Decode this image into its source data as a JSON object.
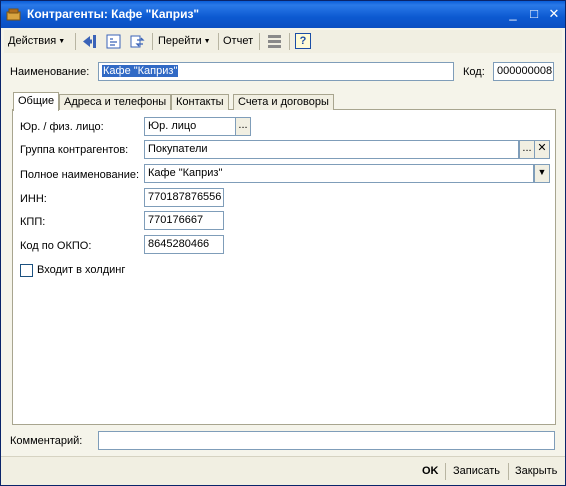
{
  "window": {
    "title": "Контрагенты: Кафе \"Каприз\"",
    "controls": {
      "minimize": "_",
      "maximize": "□",
      "close": "✕"
    }
  },
  "toolbar": {
    "actions_label": "Действия",
    "goto_label": "Перейти",
    "report_label": "Отчет",
    "help_label": "?"
  },
  "header": {
    "name_label": "Наименование:",
    "name_value": "Кафе \"Каприз\"",
    "code_label": "Код:",
    "code_value": "000000008"
  },
  "tabs": [
    {
      "label": "Общие",
      "active": true
    },
    {
      "label": "Адреса и телефоны",
      "active": false
    },
    {
      "label": "Контакты",
      "active": false
    },
    {
      "label": "Счета и договоры",
      "active": false
    }
  ],
  "general": {
    "entity_type_label": "Юр. / физ. лицо:",
    "entity_type_value": "Юр. лицо",
    "group_label": "Группа контрагентов:",
    "group_value": "Покупатели",
    "full_name_label": "Полное наименование:",
    "full_name_value": "Кафе \"Каприз\"",
    "inn_label": "ИНН:",
    "inn_value": "770187876556",
    "kpp_label": "КПП:",
    "kpp_value": "770176667",
    "okpo_label": "Код по ОКПО:",
    "okpo_value": "8645280466",
    "holding_label": "Входит в холдинг",
    "holding_checked": false
  },
  "comment": {
    "label": "Комментарий:",
    "value": ""
  },
  "footer": {
    "ok_label": "OK",
    "save_label": "Записать",
    "close_label": "Закрыть"
  },
  "colors": {
    "titlebar": "#0b58d2",
    "selection": "#316ac5",
    "field_border": "#7f9db9",
    "window_bg": "#f5f4ea"
  }
}
